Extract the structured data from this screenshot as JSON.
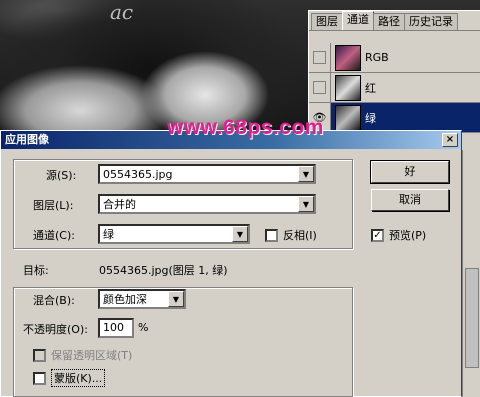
{
  "photo": {
    "scribble": "ac"
  },
  "channels_panel": {
    "tabs": [
      "图层",
      "通道",
      "路径",
      "历史记录"
    ],
    "active_tab": "通道",
    "rows": [
      {
        "name": "RGB"
      },
      {
        "name": "红"
      },
      {
        "name": "绿",
        "selected": true,
        "eye": "👁"
      }
    ]
  },
  "dialog": {
    "title": "应用图像",
    "close": "×",
    "watermark": "www.68ps.com",
    "source": {
      "label": "源(S):",
      "value": "0554365.jpg"
    },
    "layer": {
      "label": "图层(L):",
      "value": "合并的"
    },
    "channel": {
      "label": "通道(C):",
      "value": "绿"
    },
    "invert": {
      "label": "反相(I)",
      "checked": false
    },
    "target": {
      "label": "目标:",
      "value": "0554365.jpg(图层 1, 绿)"
    },
    "blending": {
      "label": "混合(B):",
      "value": "颜色加深"
    },
    "opacity": {
      "label": "不透明度(O):",
      "value": "100",
      "unit": "%"
    },
    "preserve_transparency": {
      "label": "保留透明区域(T)",
      "checked": false,
      "disabled": true
    },
    "mask": {
      "label": "蒙版(K)...",
      "checked": false
    },
    "ok_label": "好",
    "cancel_label": "取消",
    "preview": {
      "label": "预览(P)",
      "checked": true,
      "mark": "✓"
    }
  }
}
